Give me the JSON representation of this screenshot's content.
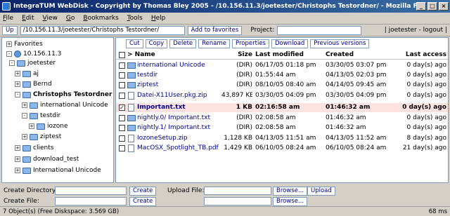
{
  "window": {
    "title": "IntegraTUM WebDisk - Copyright by Thomas Bley 2005 - /10.156.11.3/joetester/Christophs Testordner/ - Mozilla Firefox"
  },
  "menu": [
    "File",
    "Edit",
    "View",
    "Go",
    "Bookmarks",
    "Tools",
    "Help"
  ],
  "toolbar": {
    "up_label": "Up",
    "path_value": "/10.156.11.3/joetester/Christophs Testordner/",
    "add_favorites_label": "Add to favorites",
    "project_label": "Project:",
    "project_value": "",
    "user_text": "| joetester - logout |"
  },
  "tree": [
    {
      "label": "Favorites",
      "toggle": "+",
      "icon": "none"
    },
    {
      "label": "10.156.11.3",
      "toggle": "-",
      "icon": "globe"
    },
    {
      "label": "joetester",
      "toggle": "-",
      "icon": "folder"
    },
    {
      "label": "aj",
      "toggle": "+",
      "icon": "folder"
    },
    {
      "label": "Bernd",
      "toggle": "+",
      "icon": "folder"
    },
    {
      "label": "Christophs Testordner",
      "toggle": "-",
      "icon": "folder",
      "bold": true
    },
    {
      "label": "international Unicode",
      "toggle": "+",
      "icon": "folder"
    },
    {
      "label": "testdir",
      "toggle": "-",
      "icon": "folder"
    },
    {
      "label": "iozone",
      "toggle": "+",
      "icon": "folder"
    },
    {
      "label": "ziptest",
      "toggle": "+",
      "icon": "folder"
    },
    {
      "label": "clients",
      "toggle": "+",
      "icon": "folder"
    },
    {
      "label": "download_test",
      "toggle": "+",
      "icon": "folder"
    },
    {
      "label": "International Unicode",
      "toggle": "+",
      "icon": "folder"
    }
  ],
  "actions": [
    "Cut",
    "Copy",
    "Delete",
    "Rename",
    "Properties",
    "Download",
    "Previous versions"
  ],
  "table": {
    "headers": {
      "name": "> Name",
      "size": "Size",
      "modified": "Last modified",
      "created": "Created",
      "access": "Last access"
    },
    "rows": [
      {
        "name": "international Unicode",
        "size": "(DIR)",
        "modified": "06/17/05 01:18 pm",
        "created": "03/30/05 03:07 pm",
        "access": "0 day(s) ago",
        "type": "dir",
        "checked": false
      },
      {
        "name": "testdir",
        "size": "(DIR)",
        "modified": "01:55:44 am",
        "created": "04/13/05 02:03 pm",
        "access": "0 day(s) ago",
        "type": "dir",
        "checked": false
      },
      {
        "name": "ziptest",
        "size": "(DIR)",
        "modified": "08/10/05 08:40 am",
        "created": "04/14/05 09:45 am",
        "access": "0 day(s) ago",
        "type": "dir",
        "checked": false
      },
      {
        "name": "Datei-X11User.pkg.zip",
        "size": "43,897 KB",
        "modified": "03/30/05 04:09 pm",
        "created": "03/30/05 04:09 pm",
        "access": "0 day(s) ago",
        "type": "file",
        "checked": false
      },
      {
        "name": "Important.txt",
        "size": "1 KB",
        "modified": "02:16:58 am",
        "created": "01:46:32 am",
        "access": "0 day(s) ago",
        "type": "file",
        "checked": true,
        "selected": true
      },
      {
        "name": "nightly.0/ Important.txt",
        "size": "(DIR)",
        "modified": "02:08:58 am",
        "created": "01:46:32 am",
        "access": "0 day(s) ago",
        "type": "dir",
        "checked": false
      },
      {
        "name": "nightly.1/ Important.txt",
        "size": "(DIR)",
        "modified": "02:08:58 am",
        "created": "01:46:32 am",
        "access": "0 day(s) ago",
        "type": "dir",
        "checked": false
      },
      {
        "name": "IozoneSetup.zip",
        "size": "1,128 KB",
        "modified": "04/13/05 11:51 am",
        "created": "04/13/05 11:52 am",
        "access": "8 day(s) ago",
        "type": "file",
        "checked": false
      },
      {
        "name": "MacOSX_Spotlight_TB.pdf",
        "size": "1,429 KB",
        "modified": "06/10/05 08:24 am",
        "created": "06/10/05 08:24 am",
        "access": "21 day(s) ago",
        "type": "file",
        "checked": false
      }
    ]
  },
  "bottom": {
    "create_dir_label": "Create Directory:",
    "create_file_label": "Create File:",
    "create_btn": "Create",
    "upload_label": "Upload File:",
    "browse_btn": "Browse...",
    "upload_btn": "Upload"
  },
  "status": {
    "left": "7 Object(s) (Free Diskspace: 3.569 GB)",
    "right": "68 ms"
  }
}
